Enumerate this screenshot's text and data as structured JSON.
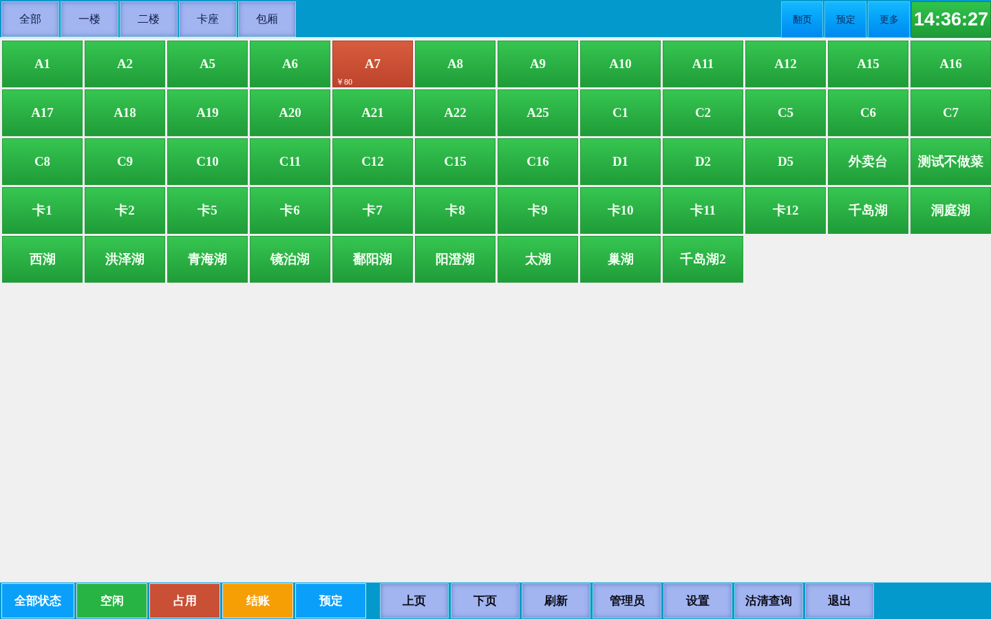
{
  "floor_tabs": [
    "全部",
    "一楼",
    "二楼",
    "卡座",
    "包厢"
  ],
  "toolbar_buttons": [
    "翻页",
    "预定",
    "更多"
  ],
  "clock": "14:36:27",
  "tables": [
    {
      "name": "A1",
      "occupied": false
    },
    {
      "name": "A2",
      "occupied": false
    },
    {
      "name": "A5",
      "occupied": false
    },
    {
      "name": "A6",
      "occupied": false
    },
    {
      "name": "A7",
      "occupied": true,
      "amount": "￥80"
    },
    {
      "name": "A8",
      "occupied": false
    },
    {
      "name": "A9",
      "occupied": false
    },
    {
      "name": "A10",
      "occupied": false
    },
    {
      "name": "A11",
      "occupied": false
    },
    {
      "name": "A12",
      "occupied": false
    },
    {
      "name": "A15",
      "occupied": false
    },
    {
      "name": "A16",
      "occupied": false
    },
    {
      "name": "A17",
      "occupied": false
    },
    {
      "name": "A18",
      "occupied": false
    },
    {
      "name": "A19",
      "occupied": false
    },
    {
      "name": "A20",
      "occupied": false
    },
    {
      "name": "A21",
      "occupied": false
    },
    {
      "name": "A22",
      "occupied": false
    },
    {
      "name": "A25",
      "occupied": false
    },
    {
      "name": "C1",
      "occupied": false
    },
    {
      "name": "C2",
      "occupied": false
    },
    {
      "name": "C5",
      "occupied": false
    },
    {
      "name": "C6",
      "occupied": false
    },
    {
      "name": "C7",
      "occupied": false
    },
    {
      "name": "C8",
      "occupied": false
    },
    {
      "name": "C9",
      "occupied": false
    },
    {
      "name": "C10",
      "occupied": false
    },
    {
      "name": "C11",
      "occupied": false
    },
    {
      "name": "C12",
      "occupied": false
    },
    {
      "name": "C15",
      "occupied": false
    },
    {
      "name": "C16",
      "occupied": false
    },
    {
      "name": "D1",
      "occupied": false
    },
    {
      "name": "D2",
      "occupied": false
    },
    {
      "name": "D5",
      "occupied": false
    },
    {
      "name": "外卖台",
      "occupied": false
    },
    {
      "name": "测试不做菜",
      "occupied": false
    },
    {
      "name": "卡1",
      "occupied": false
    },
    {
      "name": "卡2",
      "occupied": false
    },
    {
      "name": "卡5",
      "occupied": false
    },
    {
      "name": "卡6",
      "occupied": false
    },
    {
      "name": "卡7",
      "occupied": false
    },
    {
      "name": "卡8",
      "occupied": false
    },
    {
      "name": "卡9",
      "occupied": false
    },
    {
      "name": "卡10",
      "occupied": false
    },
    {
      "name": "卡11",
      "occupied": false
    },
    {
      "name": "卡12",
      "occupied": false
    },
    {
      "name": "千岛湖",
      "occupied": false
    },
    {
      "name": "洞庭湖",
      "occupied": false
    },
    {
      "name": "西湖",
      "occupied": false
    },
    {
      "name": "洪泽湖",
      "occupied": false
    },
    {
      "name": "青海湖",
      "occupied": false
    },
    {
      "name": "镜泊湖",
      "occupied": false
    },
    {
      "name": "鄱阳湖",
      "occupied": false
    },
    {
      "name": "阳澄湖",
      "occupied": false
    },
    {
      "name": "太湖",
      "occupied": false
    },
    {
      "name": "巢湖",
      "occupied": false
    },
    {
      "name": "千岛湖2",
      "occupied": false
    }
  ],
  "status_filters": [
    {
      "label": "全部状态",
      "color": "#0aa0fa"
    },
    {
      "label": "空闲",
      "color": "#28b444"
    },
    {
      "label": "占用",
      "color": "#c94f35"
    },
    {
      "label": "结账",
      "color": "#f59f05"
    },
    {
      "label": "预定",
      "color": "#0aa0fa"
    }
  ],
  "nav_buttons": [
    "上页",
    "下页",
    "刷新",
    "管理员",
    "设置",
    "沽清查询",
    "退出"
  ]
}
